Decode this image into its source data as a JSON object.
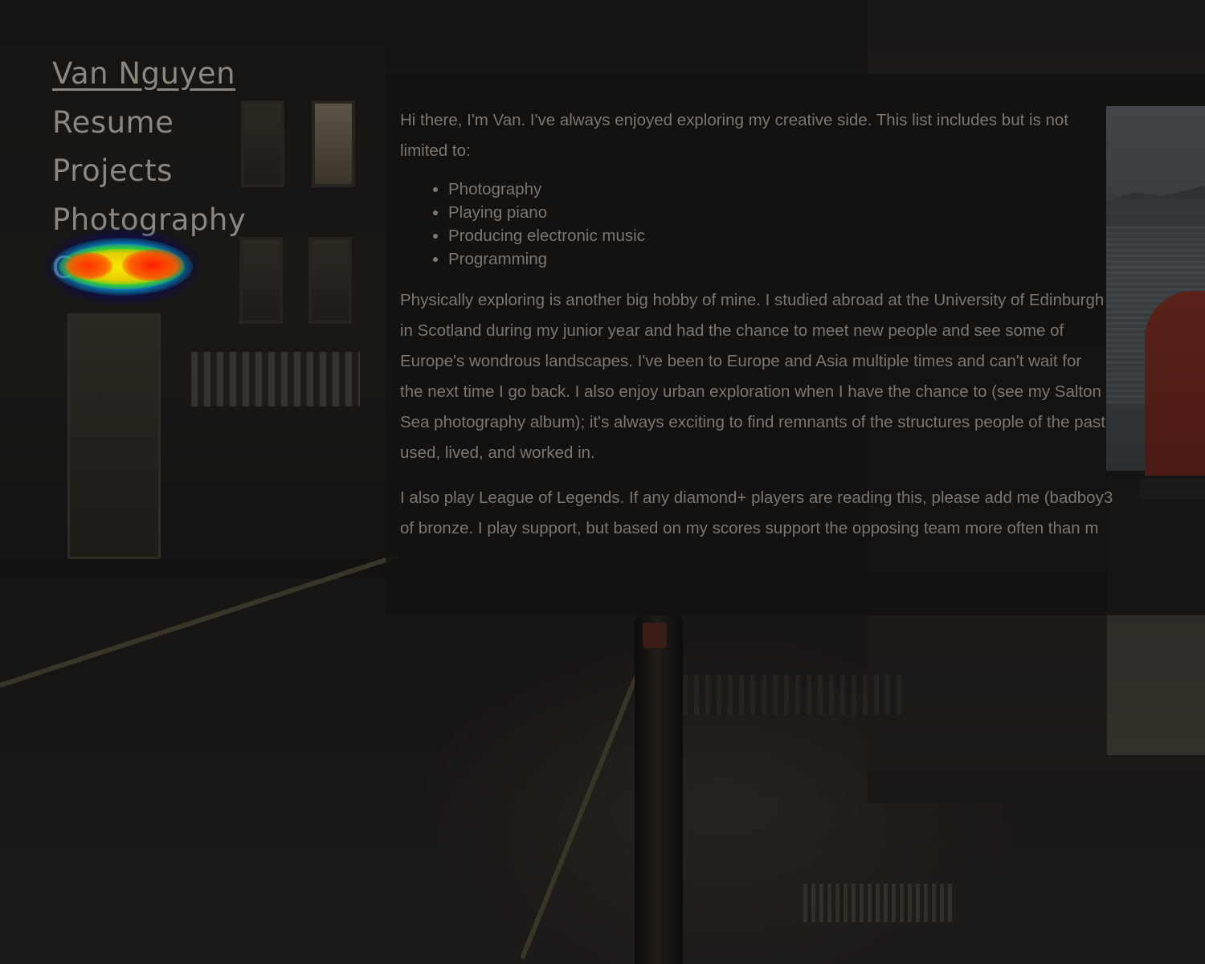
{
  "nav": {
    "home": "Van Nguyen",
    "resume": "Resume",
    "projects": "Projects",
    "photography": "Photography",
    "contact": "Contact"
  },
  "about": {
    "intro": "Hi there, I'm Van. I've always enjoyed exploring my creative side. This list includes but is not limited to:",
    "hobbies": [
      "Photography",
      "Playing piano",
      "Producing electronic music",
      "Programming"
    ],
    "explore": "Physically exploring is another big hobby of mine. I studied abroad at the University of Edinburgh in Scotland during my junior year and had the chance to meet new people and see some of Europe's wondrous landscapes. I've been to Europe and Asia multiple times and can't wait for the next time I go back. I also enjoy urban exploration when I have the chance to (see my Salton Sea photography album); it's always exciting to find remnants of the structures people of the past used, lived, and worked in.",
    "league_line1": "I also play League of Legends. If any diamond+ players are reading this, please add me (badboy3",
    "league_line2": "of bronze. I play support, but based on my scores support the opposing team more often than m"
  },
  "colors": {
    "text": "#7a7670",
    "nav_text": "#8a8680",
    "panel": "#121110"
  },
  "heatmap": {
    "target": "Contact"
  }
}
